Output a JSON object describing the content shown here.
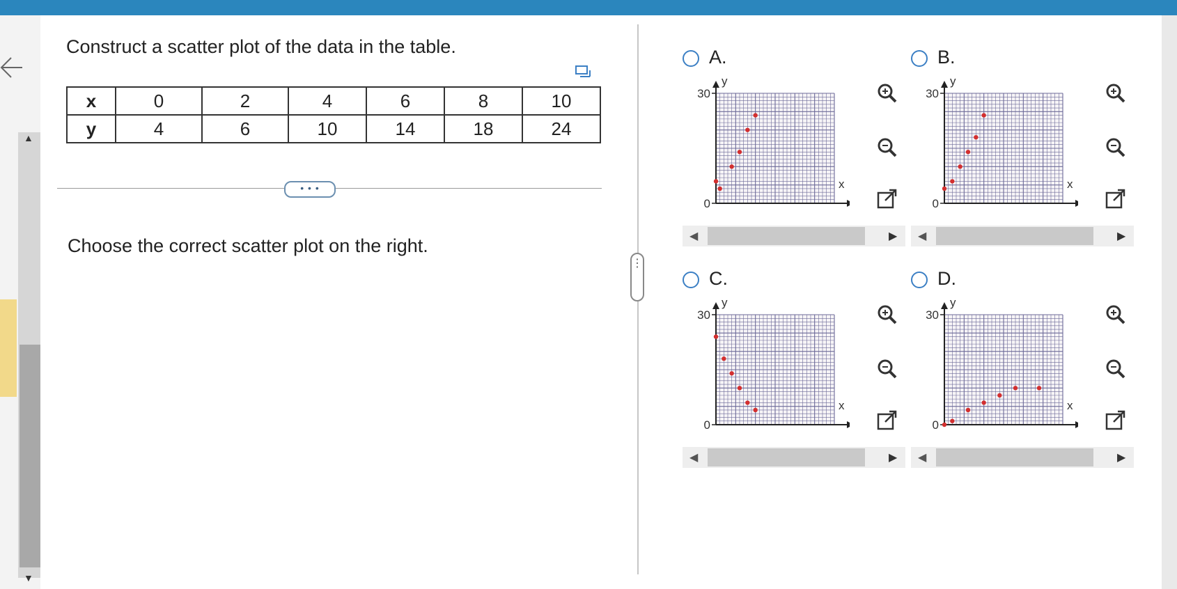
{
  "question": {
    "prompt": "Construct a scatter plot of the data in the table.",
    "instruction": "Choose the correct scatter plot on the right.",
    "more_label": "• • •"
  },
  "table": {
    "x_label": "x",
    "y_label": "y",
    "x_values": [
      "0",
      "2",
      "4",
      "6",
      "8",
      "10"
    ],
    "y_values": [
      "4",
      "6",
      "10",
      "14",
      "18",
      "24"
    ]
  },
  "options": [
    {
      "label": "A.",
      "y_axis_label": "y",
      "x_axis_label": "x",
      "y_max_label": "30",
      "origin_label": "0",
      "points": [
        [
          0,
          6
        ],
        [
          1,
          4
        ],
        [
          4,
          10
        ],
        [
          6,
          14
        ],
        [
          8,
          20
        ],
        [
          10,
          24
        ]
      ]
    },
    {
      "label": "B.",
      "y_axis_label": "y",
      "x_axis_label": "x",
      "y_max_label": "30",
      "origin_label": "0",
      "points": [
        [
          0,
          4
        ],
        [
          2,
          6
        ],
        [
          4,
          10
        ],
        [
          6,
          14
        ],
        [
          8,
          18
        ],
        [
          10,
          24
        ]
      ]
    },
    {
      "label": "C.",
      "y_axis_label": "y",
      "x_axis_label": "x",
      "y_max_label": "30",
      "origin_label": "0",
      "points": [
        [
          0,
          24
        ],
        [
          2,
          18
        ],
        [
          4,
          14
        ],
        [
          6,
          10
        ],
        [
          8,
          6
        ],
        [
          10,
          4
        ]
      ]
    },
    {
      "label": "D.",
      "y_axis_label": "y",
      "x_axis_label": "x",
      "y_max_label": "30",
      "origin_label": "0",
      "points": [
        [
          0,
          0
        ],
        [
          2,
          1
        ],
        [
          6,
          4
        ],
        [
          10,
          6
        ],
        [
          14,
          8
        ],
        [
          18,
          10
        ],
        [
          24,
          10
        ]
      ]
    }
  ],
  "colors": {
    "accent": "#2b86bd",
    "radio": "#3b7fc4",
    "grid": "#6d6a99",
    "point": "#d32f2f"
  },
  "icons": [
    "back-arrow-icon",
    "table-icon",
    "zoom-in-icon",
    "zoom-out-icon",
    "popout-icon"
  ]
}
